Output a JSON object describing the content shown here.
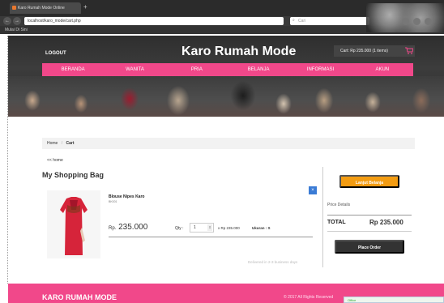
{
  "browser": {
    "tab_title": "Karo Rumah Mode Online",
    "url": "localhost/karo_mode/cart.php",
    "search_placeholder": "Cari",
    "bookmark": "Mulai Di Sini"
  },
  "header": {
    "logout": "LOGOUT",
    "title": "Karo Rumah Mode",
    "cart_summary": "Cart: Rp 235.000 (1 items)"
  },
  "menu": [
    "BERANDA",
    "WANITA",
    "PRIA",
    "BELANJA",
    "INFORMASI",
    "AKUN"
  ],
  "breadcrumb": {
    "home": "Home",
    "current": "Cart"
  },
  "home_link": "<< home",
  "bag_title": "My Shopping Bag",
  "item": {
    "name": "Blouse Nipes Karo",
    "code": "BK001",
    "price_prefix": "Rp.",
    "price": "235.000",
    "qty_label": "Qty :",
    "qty": "1",
    "line_total": "x Rp 235.000",
    "size_label": "Ukuran : S",
    "remove": "×"
  },
  "delivery_note": "Delivered in 2-3 business days",
  "summary": {
    "checkout": "Lanjut Belanja",
    "price_details": "Price Details",
    "total_label": "TOTAL",
    "total_value": "Rp 235.000",
    "place_order": "Place Order"
  },
  "footer": {
    "title": "KARO RUMAH MODE",
    "copyright": "© 2017 All Rights Reserved",
    "popup": "Office"
  },
  "colors": {
    "accent_pink": "#f1488a",
    "checkout_orange": "#f39c12",
    "dark": "#333333",
    "remove_blue": "#3a7bd5"
  }
}
